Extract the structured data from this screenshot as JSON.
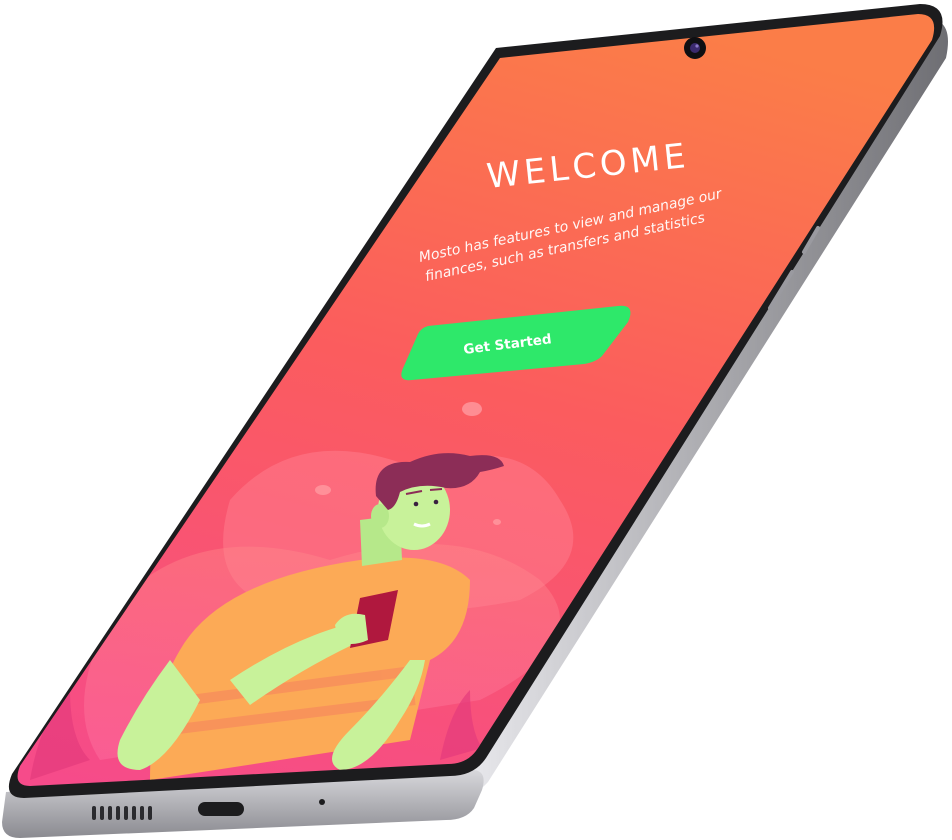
{
  "screen": {
    "title": "WELCOME",
    "description_line1": "Mosto has features to view and manage our",
    "description_line2": "finances, such as transfers and statistics",
    "cta_label": "Get Started"
  },
  "colors": {
    "gradient_top": "#fb7b4a",
    "gradient_mid": "#fb5b63",
    "gradient_bottom": "#f94d86",
    "cta_green": "#2ee86a",
    "frame_dark": "#1c1c1e",
    "frame_silver": "#c8c8cc"
  },
  "icons": {
    "camera": "front-camera-icon",
    "speaker": "speaker-grille-icon",
    "port": "usb-c-port-icon",
    "mic": "microphone-icon"
  }
}
